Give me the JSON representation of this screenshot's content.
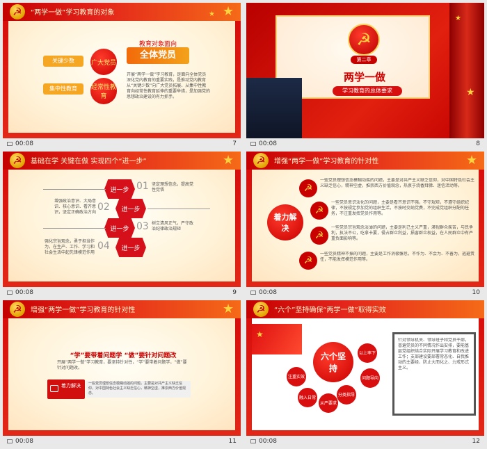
{
  "thumbnails": [
    {
      "time": "00:08",
      "number": "7",
      "title": "“两学一做”学习教育的对象",
      "left_labels": [
        "关键少数",
        "集中性教育"
      ],
      "circles": [
        "广大党员",
        "经常性教育"
      ],
      "banner_top": "教育对象面向",
      "banner_main": "全体党员",
      "body": "开展“两学一做”学习教育，是面向全体党员深化党内教育的重要实践，是推动党内教育从“关键少数”向广大党员拓展、从集中性教育向经常性教育延伸的重要举措，是加强党的思想政治建设的有力抓手。"
    },
    {
      "time": "00:08",
      "number": "8",
      "chapter": "第二章",
      "main_title": "两学一做",
      "subtitle": "学习教育的总体要求"
    },
    {
      "time": "00:08",
      "number": "9",
      "title": "基础在学 关键在做 实现四个“进一步”",
      "hex": [
        "进一步",
        "进一步",
        "进一步",
        "进一步"
      ],
      "nums": [
        "01",
        "02",
        "03",
        "04"
      ],
      "texts": [
        "坚定理想信念，提高党性觉悟",
        "增强政治意识、大局意识、核心意识、看齐意识，坚定正确政治方向",
        "树立清风正气，严守政治纪律政治规矩",
        "强化宗旨观念，勇于担当作为，在生产、工作、学习和社会生活中起先锋模范作用"
      ]
    },
    {
      "time": "00:08",
      "number": "10",
      "title": "增强“两学一做”学习教育的针对性",
      "center": "着力解决",
      "items": [
        "一些党员理想信念模糊动摇的问题，主要是对共产主义缺乏信仰，对中国特色社会主义缺乏信心，精神空虚，推崇西方价值观念，热衷于烧香拜佛、迷信活动等。",
        "一些党员意识淡化的问题，主要是看齐意识不强，不守规矩，不遵守组织纪律，不按规定参加党的组织生活，不按时交纳党费，不完成党组织分配的任务，不注重发挥党员作用等。",
        "一些党员宗旨观念淡薄的问题，主要是利己主义严重，漠视群众疾苦，与民争利，执法不公，吃拿卡要，侵占群众利益，损害群众权益，在人民群众中有严重负面影响等。",
        "一些党员精神不振的问题，主要是工作消极懈怠，不作为、不会为、不善为，逃避责任，不能发挥模范作用等。"
      ]
    },
    {
      "time": "00:08",
      "number": "11",
      "title": "增强“两学一做”学习教育的针对性",
      "headline": "“学”要带着问题学 “做”要针对问题改",
      "desc": "开展“两学一做”学习教育，要坚持针对性，“学”要带着问题学，“做”要针对问题改。",
      "label": "着力解决",
      "small": "一些党员理想信念模糊动摇的问题，主要是对共产主义缺乏信仰，对中国特色社会主义缺乏信心，精神空虚，推崇西方价值观念。"
    },
    {
      "time": "00:08",
      "number": "12",
      "title": "“六个”坚持确保“两学一做”取得实效",
      "center": "六个坚持",
      "satellites": [
        "以上率下",
        "问题导向",
        "分类指导",
        "从严要求",
        "融入日常",
        "注重实效"
      ],
      "body": "针对领导机关、领导班子和党员干部，普遍党员的不同情况作出安排，要能基层党组织结合实际开展学习教育和改进工作；支部建设要部署常态化、自我推动的主要经、防止大而化之、力戒形式主义。"
    }
  ]
}
